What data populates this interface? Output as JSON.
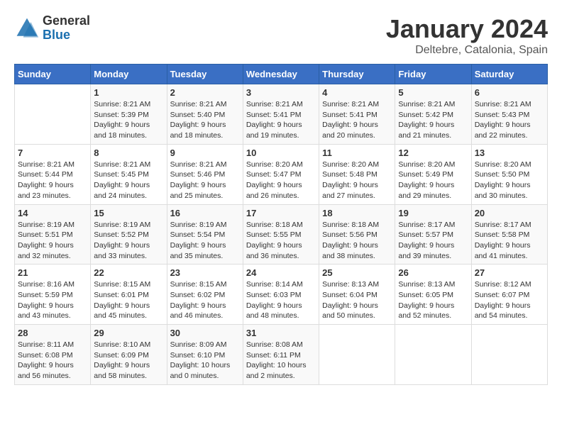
{
  "header": {
    "logo_general": "General",
    "logo_blue": "Blue",
    "month_title": "January 2024",
    "location": "Deltebre, Catalonia, Spain"
  },
  "days_of_week": [
    "Sunday",
    "Monday",
    "Tuesday",
    "Wednesday",
    "Thursday",
    "Friday",
    "Saturday"
  ],
  "weeks": [
    [
      {
        "day": "",
        "info": ""
      },
      {
        "day": "1",
        "info": "Sunrise: 8:21 AM\nSunset: 5:39 PM\nDaylight: 9 hours\nand 18 minutes."
      },
      {
        "day": "2",
        "info": "Sunrise: 8:21 AM\nSunset: 5:40 PM\nDaylight: 9 hours\nand 18 minutes."
      },
      {
        "day": "3",
        "info": "Sunrise: 8:21 AM\nSunset: 5:41 PM\nDaylight: 9 hours\nand 19 minutes."
      },
      {
        "day": "4",
        "info": "Sunrise: 8:21 AM\nSunset: 5:41 PM\nDaylight: 9 hours\nand 20 minutes."
      },
      {
        "day": "5",
        "info": "Sunrise: 8:21 AM\nSunset: 5:42 PM\nDaylight: 9 hours\nand 21 minutes."
      },
      {
        "day": "6",
        "info": "Sunrise: 8:21 AM\nSunset: 5:43 PM\nDaylight: 9 hours\nand 22 minutes."
      }
    ],
    [
      {
        "day": "7",
        "info": "Sunrise: 8:21 AM\nSunset: 5:44 PM\nDaylight: 9 hours\nand 23 minutes."
      },
      {
        "day": "8",
        "info": "Sunrise: 8:21 AM\nSunset: 5:45 PM\nDaylight: 9 hours\nand 24 minutes."
      },
      {
        "day": "9",
        "info": "Sunrise: 8:21 AM\nSunset: 5:46 PM\nDaylight: 9 hours\nand 25 minutes."
      },
      {
        "day": "10",
        "info": "Sunrise: 8:20 AM\nSunset: 5:47 PM\nDaylight: 9 hours\nand 26 minutes."
      },
      {
        "day": "11",
        "info": "Sunrise: 8:20 AM\nSunset: 5:48 PM\nDaylight: 9 hours\nand 27 minutes."
      },
      {
        "day": "12",
        "info": "Sunrise: 8:20 AM\nSunset: 5:49 PM\nDaylight: 9 hours\nand 29 minutes."
      },
      {
        "day": "13",
        "info": "Sunrise: 8:20 AM\nSunset: 5:50 PM\nDaylight: 9 hours\nand 30 minutes."
      }
    ],
    [
      {
        "day": "14",
        "info": "Sunrise: 8:19 AM\nSunset: 5:51 PM\nDaylight: 9 hours\nand 32 minutes."
      },
      {
        "day": "15",
        "info": "Sunrise: 8:19 AM\nSunset: 5:52 PM\nDaylight: 9 hours\nand 33 minutes."
      },
      {
        "day": "16",
        "info": "Sunrise: 8:19 AM\nSunset: 5:54 PM\nDaylight: 9 hours\nand 35 minutes."
      },
      {
        "day": "17",
        "info": "Sunrise: 8:18 AM\nSunset: 5:55 PM\nDaylight: 9 hours\nand 36 minutes."
      },
      {
        "day": "18",
        "info": "Sunrise: 8:18 AM\nSunset: 5:56 PM\nDaylight: 9 hours\nand 38 minutes."
      },
      {
        "day": "19",
        "info": "Sunrise: 8:17 AM\nSunset: 5:57 PM\nDaylight: 9 hours\nand 39 minutes."
      },
      {
        "day": "20",
        "info": "Sunrise: 8:17 AM\nSunset: 5:58 PM\nDaylight: 9 hours\nand 41 minutes."
      }
    ],
    [
      {
        "day": "21",
        "info": "Sunrise: 8:16 AM\nSunset: 5:59 PM\nDaylight: 9 hours\nand 43 minutes."
      },
      {
        "day": "22",
        "info": "Sunrise: 8:15 AM\nSunset: 6:01 PM\nDaylight: 9 hours\nand 45 minutes."
      },
      {
        "day": "23",
        "info": "Sunrise: 8:15 AM\nSunset: 6:02 PM\nDaylight: 9 hours\nand 46 minutes."
      },
      {
        "day": "24",
        "info": "Sunrise: 8:14 AM\nSunset: 6:03 PM\nDaylight: 9 hours\nand 48 minutes."
      },
      {
        "day": "25",
        "info": "Sunrise: 8:13 AM\nSunset: 6:04 PM\nDaylight: 9 hours\nand 50 minutes."
      },
      {
        "day": "26",
        "info": "Sunrise: 8:13 AM\nSunset: 6:05 PM\nDaylight: 9 hours\nand 52 minutes."
      },
      {
        "day": "27",
        "info": "Sunrise: 8:12 AM\nSunset: 6:07 PM\nDaylight: 9 hours\nand 54 minutes."
      }
    ],
    [
      {
        "day": "28",
        "info": "Sunrise: 8:11 AM\nSunset: 6:08 PM\nDaylight: 9 hours\nand 56 minutes."
      },
      {
        "day": "29",
        "info": "Sunrise: 8:10 AM\nSunset: 6:09 PM\nDaylight: 9 hours\nand 58 minutes."
      },
      {
        "day": "30",
        "info": "Sunrise: 8:09 AM\nSunset: 6:10 PM\nDaylight: 10 hours\nand 0 minutes."
      },
      {
        "day": "31",
        "info": "Sunrise: 8:08 AM\nSunset: 6:11 PM\nDaylight: 10 hours\nand 2 minutes."
      },
      {
        "day": "",
        "info": ""
      },
      {
        "day": "",
        "info": ""
      },
      {
        "day": "",
        "info": ""
      }
    ]
  ]
}
